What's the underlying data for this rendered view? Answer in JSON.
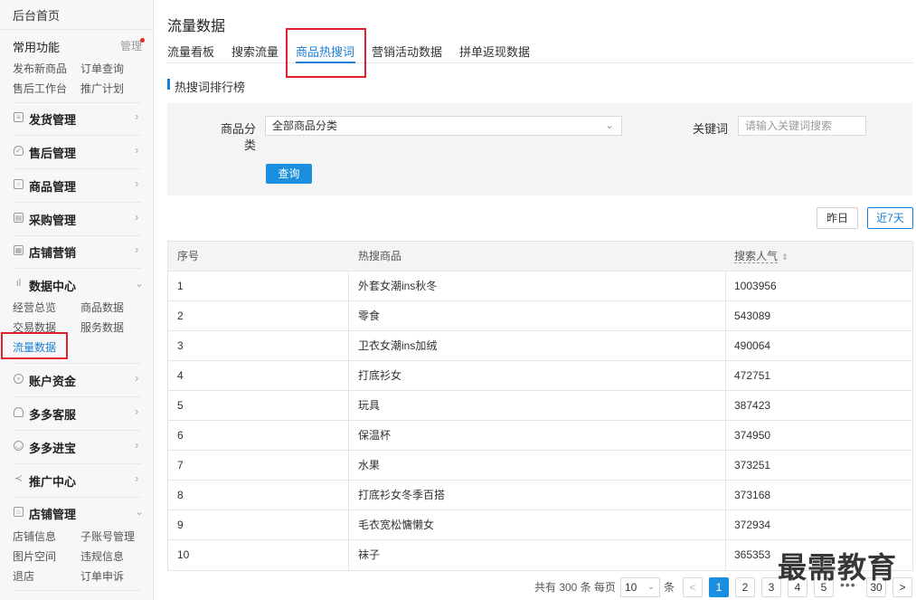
{
  "sidebar": {
    "home": "后台首页",
    "common": "常用功能",
    "manage": "管理",
    "shortcuts": [
      "发布新商品",
      "订单查询",
      "售后工作台",
      "推广计划"
    ],
    "menus": [
      {
        "label": "发货管理",
        "icon": "list-icon"
      },
      {
        "label": "售后管理",
        "icon": "shield-icon"
      },
      {
        "label": "商品管理",
        "icon": "bag-icon"
      },
      {
        "label": "采购管理",
        "icon": "cart-icon"
      },
      {
        "label": "店铺营销",
        "icon": "calendar-icon"
      },
      {
        "label": "数据中心",
        "icon": "bar-chart-icon"
      },
      {
        "label": "账户资金",
        "icon": "coin-icon"
      },
      {
        "label": "多多客服",
        "icon": "headset-icon"
      },
      {
        "label": "多多进宝",
        "icon": "treasure-icon"
      },
      {
        "label": "推广中心",
        "icon": "share-icon"
      },
      {
        "label": "店铺管理",
        "icon": "store-icon"
      }
    ],
    "data_links": [
      "经营总览",
      "商品数据",
      "交易数据",
      "服务数据",
      "流量数据"
    ],
    "shop_links": [
      "店铺信息",
      "子账号管理",
      "图片空间",
      "违规信息",
      "退店",
      "订单申诉"
    ]
  },
  "page": {
    "title": "流量数据",
    "tabs": [
      "流量看板",
      "搜索流量",
      "商品热搜词",
      "营销活动数据",
      "拼单返现数据"
    ],
    "section_title": "热搜词排行榜"
  },
  "filter": {
    "category_label_1": "商品分",
    "category_label_2": "类",
    "category_value": "全部商品分类",
    "keyword_label": "关键词",
    "keyword_placeholder": "请输入关键词搜索",
    "query": "查询"
  },
  "range": {
    "yesterday": "昨日",
    "last7": "近7天"
  },
  "table": {
    "headers": [
      "序号",
      "热搜商品",
      "搜索人气"
    ],
    "rows": [
      [
        "1",
        "外套女潮ins秋冬",
        "1003956"
      ],
      [
        "2",
        "零食",
        "543089"
      ],
      [
        "3",
        "卫衣女潮ins加绒",
        "490064"
      ],
      [
        "4",
        "打底衫女",
        "472751"
      ],
      [
        "5",
        "玩具",
        "387423"
      ],
      [
        "6",
        "保温杯",
        "374950"
      ],
      [
        "7",
        "水果",
        "373251"
      ],
      [
        "8",
        "打底衫女冬季百搭",
        "373168"
      ],
      [
        "9",
        "毛衣宽松慵懒女",
        "372934"
      ],
      [
        "10",
        "袜子",
        "365353"
      ]
    ]
  },
  "pagination": {
    "total": "共有 300 条",
    "per_page": "每页",
    "size": "10",
    "unit": "条",
    "prev": "<",
    "pages": [
      "1",
      "2",
      "3",
      "4",
      "5"
    ],
    "dots": "•••",
    "last": "30",
    "next": ">"
  },
  "watermark": "最需教育",
  "colors": {
    "accent": "#1a7ed8",
    "highlight": "#e0202a"
  }
}
